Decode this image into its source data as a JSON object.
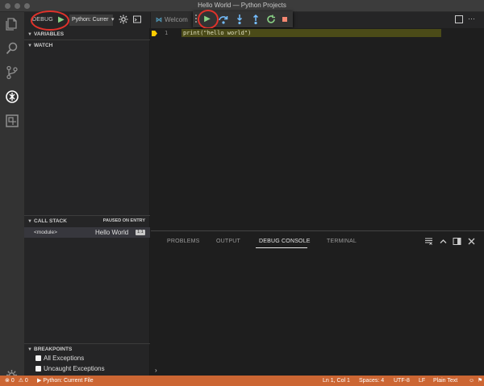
{
  "window": {
    "title": "Hello World — Python Projects"
  },
  "debug_toolbar": {
    "label": "DEBUG",
    "configuration": "Python: Currer",
    "start_glyph": "▶"
  },
  "sidebar": {
    "variables_label": "VARIABLES",
    "watch_label": "WATCH",
    "call_stack": {
      "label": "CALL STACK",
      "status": "PAUSED ON ENTRY",
      "frames": [
        {
          "function": "<module>",
          "file": "Hello World",
          "position": "1:1"
        }
      ]
    },
    "breakpoints": {
      "label": "BREAKPOINTS",
      "items": [
        {
          "label": "All Exceptions"
        },
        {
          "label": "Uncaught Exceptions"
        }
      ]
    }
  },
  "editor": {
    "tab_label": "Welcom",
    "tab_prefix": "⋈",
    "line_number": "1",
    "code_line": "print(\"hello world\")"
  },
  "panel": {
    "tabs": [
      "PROBLEMS",
      "OUTPUT",
      "DEBUG CONSOLE",
      "TERMINAL"
    ],
    "active_tab": "DEBUG CONSOLE",
    "prompt": "›"
  },
  "status_bar": {
    "errors": "0",
    "warnings": "0",
    "debug_config": "Python: Current File",
    "cursor": "Ln 1, Col 1",
    "spaces": "Spaces: 4",
    "encoding": "UTF-8",
    "eol": "LF",
    "language": "Plain Text"
  },
  "colors": {
    "status_bar_debug": "#cc6633",
    "annotation_circle": "#e0322b",
    "continue_green": "#89d185",
    "step_blue": "#75beff",
    "restart_green": "#89d185",
    "stop_red": "#f48771",
    "current_line_highlight": "#4b4b18",
    "paused_arrow": "#ffcc00"
  },
  "icons": {
    "activity_bar": [
      "files-icon",
      "search-icon",
      "source-control-icon",
      "debug-icon",
      "extensions-icon",
      "settings-gear-icon"
    ],
    "float_toolbar": [
      "continue-icon",
      "step-over-icon",
      "step-into-icon",
      "step-out-icon",
      "restart-icon",
      "stop-icon"
    ]
  }
}
